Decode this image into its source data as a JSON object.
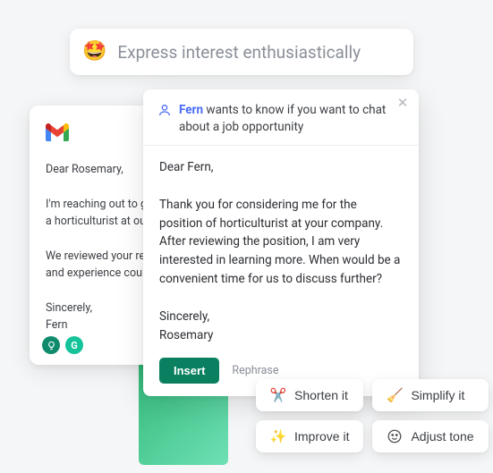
{
  "prompt": {
    "emoji": "🤩",
    "text": "Express interest enthusiastically"
  },
  "gmail": {
    "body": "Dear Rosemary,\n\nI'm reaching out to g\na horticulturist at ou\n\nWe reviewed your re\nand experience coul\n\nSincerely,\nFern"
  },
  "reply": {
    "sender": "Fern",
    "header_text": " wants to know if you want to chat about a job opportunity",
    "body": "Dear Fern,\n\nThank you for considering me for the position of horticulturist at your company. After reviewing the position, I am very interested in learning more. When would be a convenient time for us to discuss further?\n\nSincerely,\nRosemary",
    "insert_label": "Insert",
    "rephrase_label": "Rephrase"
  },
  "chips": {
    "shorten": "Shorten it",
    "simplify": "Simplify it",
    "improve": "Improve it",
    "adjust": "Adjust tone"
  }
}
